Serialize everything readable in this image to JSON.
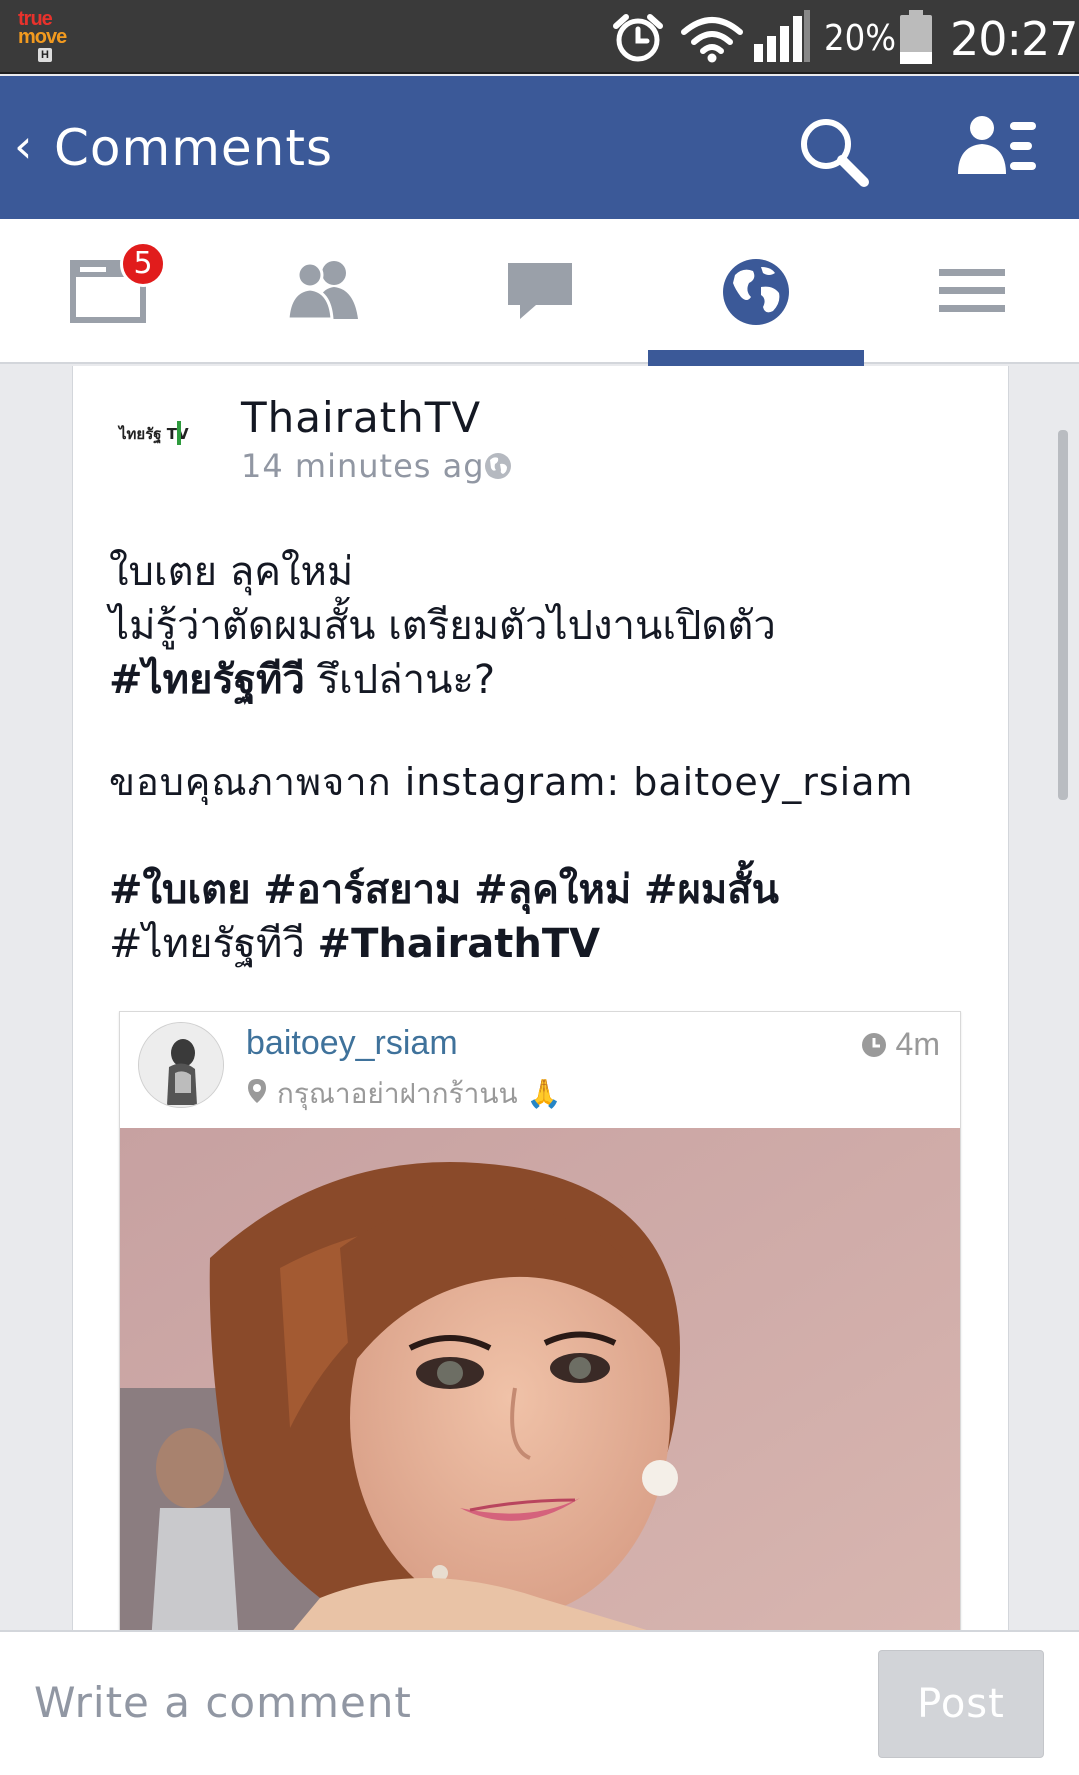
{
  "status_bar": {
    "carrier_line1": "true",
    "carrier_line2": "move",
    "carrier_network": "H",
    "battery_percent": "20%",
    "time": "20:27"
  },
  "header": {
    "back_glyph": "‹",
    "title": "Comments",
    "search_icon": "search-icon",
    "friends_icon": "friend-requests-icon"
  },
  "tabs": [
    {
      "name": "news-feed",
      "icon": "news-feed-icon",
      "badge": "5"
    },
    {
      "name": "friends",
      "icon": "friends-icon"
    },
    {
      "name": "messages",
      "icon": "messages-icon"
    },
    {
      "name": "notifications",
      "icon": "globe-icon",
      "active": true
    },
    {
      "name": "more",
      "icon": "menu-icon"
    }
  ],
  "post": {
    "author": "ThairathTV",
    "logo_text": "ไทยรัฐ TV",
    "timestamp": "14 minutes ago",
    "line1": "ใบเตย ลุคใหม่",
    "line2": "ไม่รู้ว่าตัดผมสั้น เตรียมตัวไปงานเปิดตัว",
    "line3_tag": "#ไทยรัฐทีวี",
    "line3_rest": " รึเปล่านะ?",
    "credits": "ขอบคุณภาพจาก instagram: baitoey_rsiam",
    "tags_line1": [
      "#ใบเตย",
      "#อาร์สยาม",
      "#ลุคใหม่",
      "#ผมสั้น"
    ],
    "tags_line2_plain": "#ไทยรัฐทีวี",
    "tags_line2_bold": "#ThairathTV"
  },
  "instagram": {
    "username": "baitoey_rsiam",
    "location": "กรุณาอย่าฝากร้านน",
    "emoji": "🙏",
    "time": "4m"
  },
  "comment_bar": {
    "placeholder": "Write a comment",
    "post_label": "Post"
  },
  "colors": {
    "brand_blue": "#3b5998",
    "badge_red": "#e11c1c",
    "instagram_blue": "#3f729b"
  }
}
